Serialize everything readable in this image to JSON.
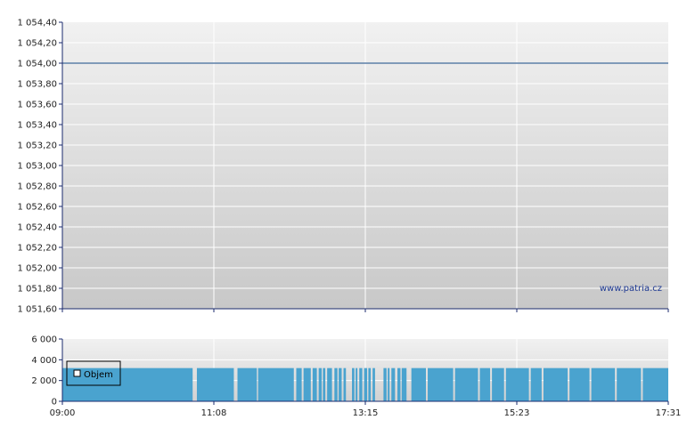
{
  "watermark": "www.patria.cz",
  "colors": {
    "price_line": "#5c7fa8",
    "volume_bar": "#4aa3cf",
    "grid": "#ffffff",
    "bg_top": "#f1f1f1",
    "bg_bottom": "#c8c8c8",
    "axis": "#1a2a6c"
  },
  "chart_data": [
    {
      "type": "line",
      "series": [
        {
          "x": [
            "09:00",
            "17:31"
          ],
          "values": [
            1054.0,
            1054.0
          ]
        }
      ],
      "ylim": [
        1051.6,
        1054.4
      ],
      "yticks": [
        "1 054,40",
        "1 054,20",
        "1 054,00",
        "1 053,80",
        "1 053,60",
        "1 053,40",
        "1 053,20",
        "1 053,00",
        "1 052,80",
        "1 052,60",
        "1 052,40",
        "1 052,20",
        "1 052,00",
        "1 051,80",
        "1 051,60"
      ],
      "grid": true
    },
    {
      "type": "bar",
      "legend": "Objem",
      "legend_placement": "left",
      "ylim": [
        0,
        6000
      ],
      "yticks": [
        "6 000",
        "4 000",
        "2 000",
        "0"
      ],
      "xticks": [
        "09:00",
        "11:08",
        "13:15",
        "15:23",
        "17:31"
      ],
      "bar_value": 3200,
      "gaps": [
        [
          0.215,
          0.222
        ],
        [
          0.283,
          0.289
        ],
        [
          0.321,
          0.323
        ],
        [
          0.382,
          0.386
        ],
        [
          0.395,
          0.398
        ],
        [
          0.41,
          0.413
        ],
        [
          0.42,
          0.423
        ],
        [
          0.428,
          0.43
        ],
        [
          0.434,
          0.437
        ],
        [
          0.445,
          0.449
        ],
        [
          0.454,
          0.456
        ],
        [
          0.461,
          0.464
        ],
        [
          0.468,
          0.478
        ],
        [
          0.482,
          0.484
        ],
        [
          0.487,
          0.49
        ],
        [
          0.495,
          0.498
        ],
        [
          0.503,
          0.505
        ],
        [
          0.509,
          0.512
        ],
        [
          0.516,
          0.53
        ],
        [
          0.535,
          0.537
        ],
        [
          0.54,
          0.543
        ],
        [
          0.549,
          0.553
        ],
        [
          0.558,
          0.56
        ],
        [
          0.568,
          0.576
        ],
        [
          0.6,
          0.603
        ],
        [
          0.645,
          0.648
        ],
        [
          0.686,
          0.689
        ],
        [
          0.706,
          0.709
        ],
        [
          0.729,
          0.732
        ],
        [
          0.77,
          0.773
        ],
        [
          0.791,
          0.794
        ],
        [
          0.834,
          0.837
        ],
        [
          0.87,
          0.873
        ],
        [
          0.912,
          0.915
        ],
        [
          0.955,
          0.958
        ]
      ],
      "grid": true
    }
  ]
}
